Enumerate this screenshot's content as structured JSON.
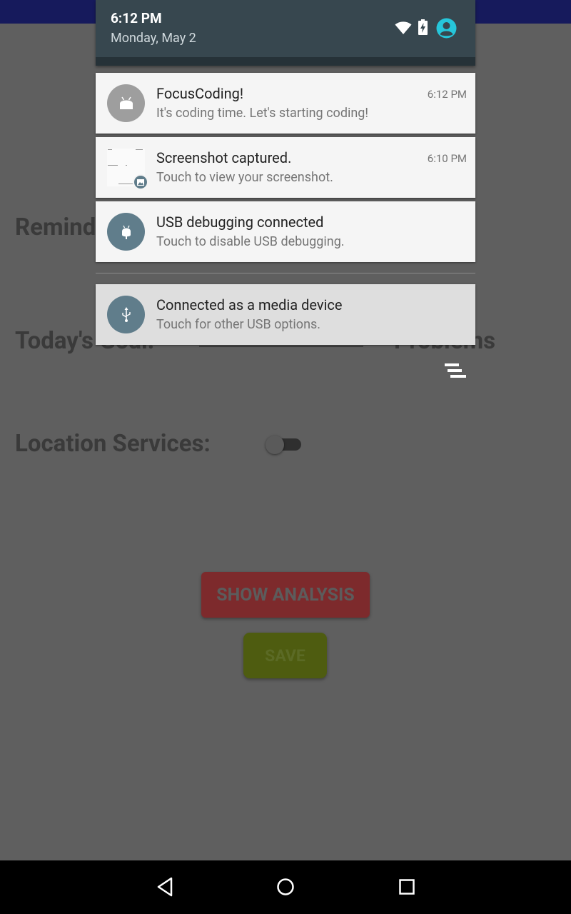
{
  "status": {
    "time": "6:12 PM",
    "date": "Monday, May 2",
    "icons": [
      "wifi-icon",
      "battery-charging-icon",
      "user-account-icon"
    ]
  },
  "app_background": {
    "labels": [
      "Remind",
      "Today's Goal:",
      "Problems",
      "Location Services:"
    ],
    "location_toggle": "off",
    "show_analysis_label": "SHOW ANALYSIS",
    "save_label": "SAVE"
  },
  "notifications": [
    {
      "icon": "android-icon",
      "title": "FocusCoding!",
      "text": "It's coding time. Let's starting coding!",
      "time": "6:12 PM"
    },
    {
      "icon": "screenshot-thumbnail",
      "title": "Screenshot captured.",
      "text": "Touch to view your screenshot.",
      "time": "6:10 PM"
    },
    {
      "icon": "usb-debug-android-icon",
      "title": "USB debugging connected",
      "text": "Touch to disable USB debugging.",
      "time": ""
    },
    {
      "icon": "usb-icon",
      "title": "Connected as a media device",
      "text": "Touch for other USB options.",
      "time": ""
    }
  ],
  "colors": {
    "shade_header": "#37474f",
    "notification_bg": "#f5f5f5",
    "icon_circle_gray": "#9e9e9e",
    "icon_circle_bluegray": "#607d8b",
    "account_icon": "#26c6da"
  }
}
